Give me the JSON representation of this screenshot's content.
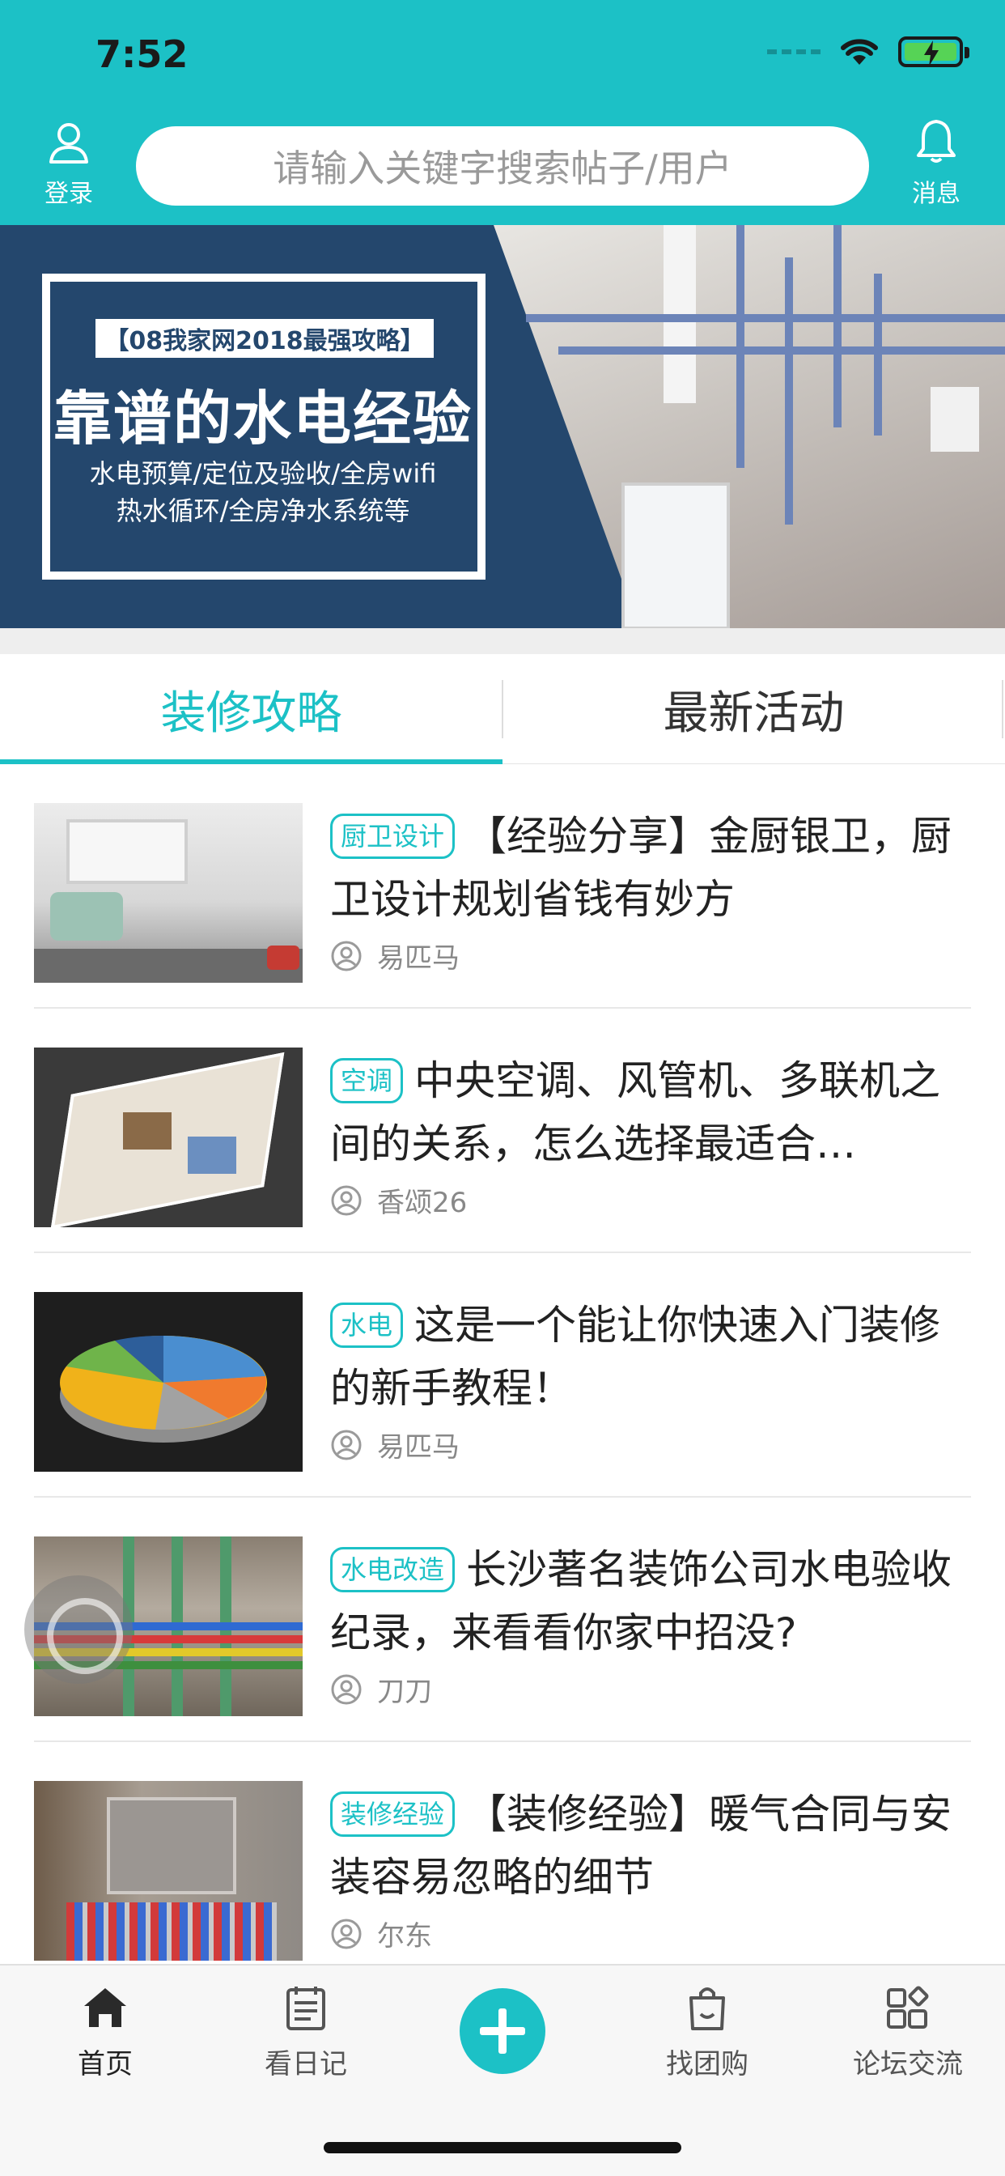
{
  "status_bar": {
    "time": "7:52"
  },
  "header": {
    "login_label": "登录",
    "search_placeholder": "请输入关键字搜索帖子/用户",
    "messages_label": "消息"
  },
  "banner": {
    "tag": "【08我家网2018最强攻略】",
    "title": "靠谱的水电经验",
    "subtitle_line1": "水电预算/定位及验收/全房wifi",
    "subtitle_line2": "热水循环/全房净水系统等"
  },
  "tabs": [
    {
      "label": "装修攻略",
      "active": true
    },
    {
      "label": "最新活动",
      "active": false
    }
  ],
  "posts": [
    {
      "badge": "厨卫设计",
      "title": "【经验分享】金厨银卫，厨卫设计规划省钱有妙方",
      "author": "易匹马",
      "thumb": "kitchen-photo"
    },
    {
      "badge": "空调",
      "title": "中央空调、风管机、多联机之间的关系，怎么选择最适合…",
      "author": "香颂26",
      "thumb": "floorplan-3d-photo"
    },
    {
      "badge": "水电",
      "title": "这是一个能让你快速入门装修的新手教程！",
      "author": "易匹马",
      "thumb": "pie-chart-photo"
    },
    {
      "badge": "水电改造",
      "title": "长沙著名装饰公司水电验收纪录，来看看你家中招没?",
      "author": "刀刀",
      "thumb": "pipes-wall-photo"
    },
    {
      "badge": "装修经验",
      "title": "【装修经验】暖气合同与安装容易忽略的细节",
      "author": "尔东",
      "thumb": "manifold-photo"
    }
  ],
  "bottom_nav": [
    {
      "label": "首页",
      "icon": "home-icon",
      "active": true
    },
    {
      "label": "看日记",
      "icon": "diary-icon",
      "active": false
    },
    {
      "label": "",
      "icon": "plus-icon",
      "active": false
    },
    {
      "label": "找团购",
      "icon": "shopping-bag-icon",
      "active": false
    },
    {
      "label": "论坛交流",
      "icon": "grid-icon",
      "active": false
    }
  ],
  "colors": {
    "accent": "#1cc1c6",
    "banner_bg": "#24476d"
  }
}
